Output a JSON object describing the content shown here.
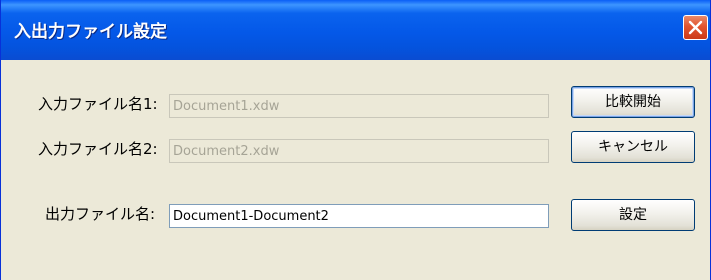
{
  "window": {
    "title": "入出力ファイル設定",
    "close_icon": "close-icon"
  },
  "form": {
    "input1_label": "入力ファイル名1:",
    "input1_value": "Document1.xdw",
    "input2_label": "入力ファイル名2:",
    "input2_value": "Document2.xdw",
    "output_label": "出力ファイル名:",
    "output_value": "Document1-Document2"
  },
  "buttons": {
    "compare_label": "比較開始",
    "cancel_label": "キャンセル",
    "settings_label": "設定"
  }
}
